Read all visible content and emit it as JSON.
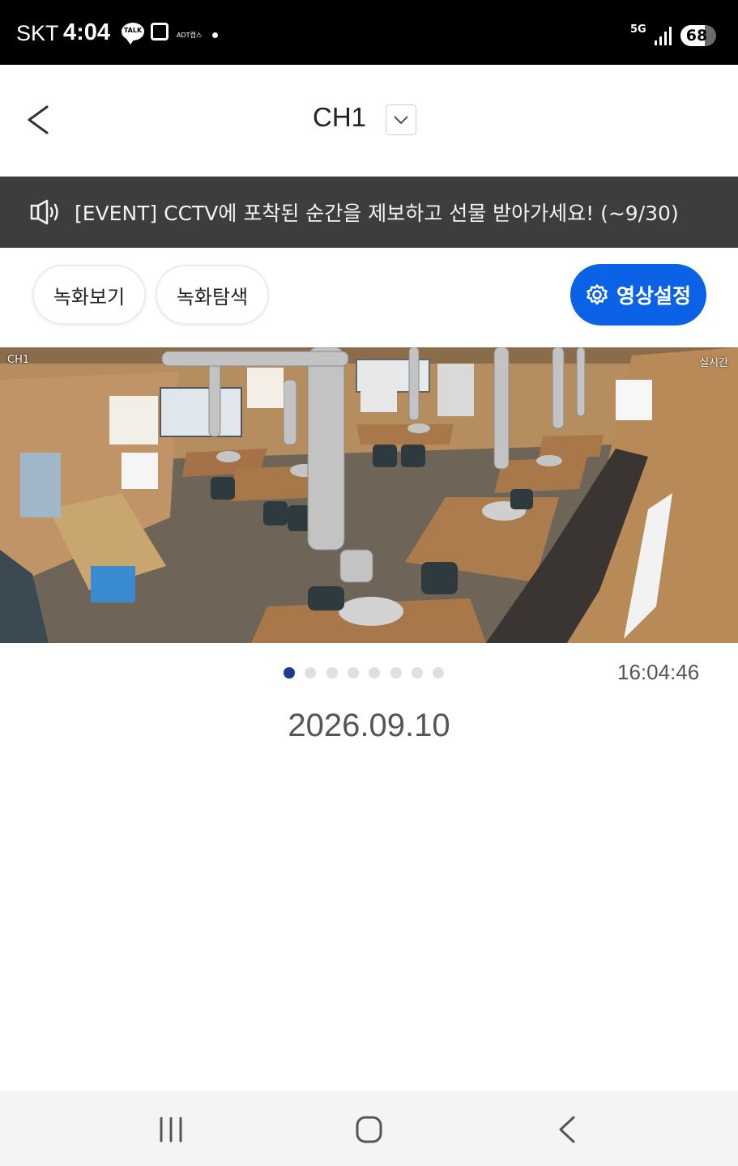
{
  "status_bar": {
    "carrier": "SKT",
    "time": "4:04",
    "talk_badge": "TALK",
    "adt_label": "ADT캡스",
    "network": "5G",
    "battery": "68",
    "battery_level": 0.68
  },
  "header": {
    "title": "CH1"
  },
  "banner": {
    "text": "[EVENT] CCTV에 포착된 순간을 제보하고 선물 받아가세요! (~9/30)"
  },
  "actions": {
    "recording_view": "녹화보기",
    "recording_search": "녹화탐색",
    "video_settings": "영상설정"
  },
  "video": {
    "channel_label": "CH1",
    "live_label": "실시간"
  },
  "pager": {
    "total": 8,
    "active_index": 0
  },
  "clock": "16:04:46",
  "date": "2026.09.10",
  "colors": {
    "accent": "#0c62e6",
    "banner_bg": "#3d3d3d",
    "active_dot": "#1a3a96"
  },
  "icons": {
    "back": "chevron-left-icon",
    "dropdown": "chevron-down-icon",
    "banner": "megaphone-icon",
    "settings": "gear-icon",
    "nav_recents": "recents-icon",
    "nav_home": "home-icon",
    "nav_back": "back-icon"
  }
}
